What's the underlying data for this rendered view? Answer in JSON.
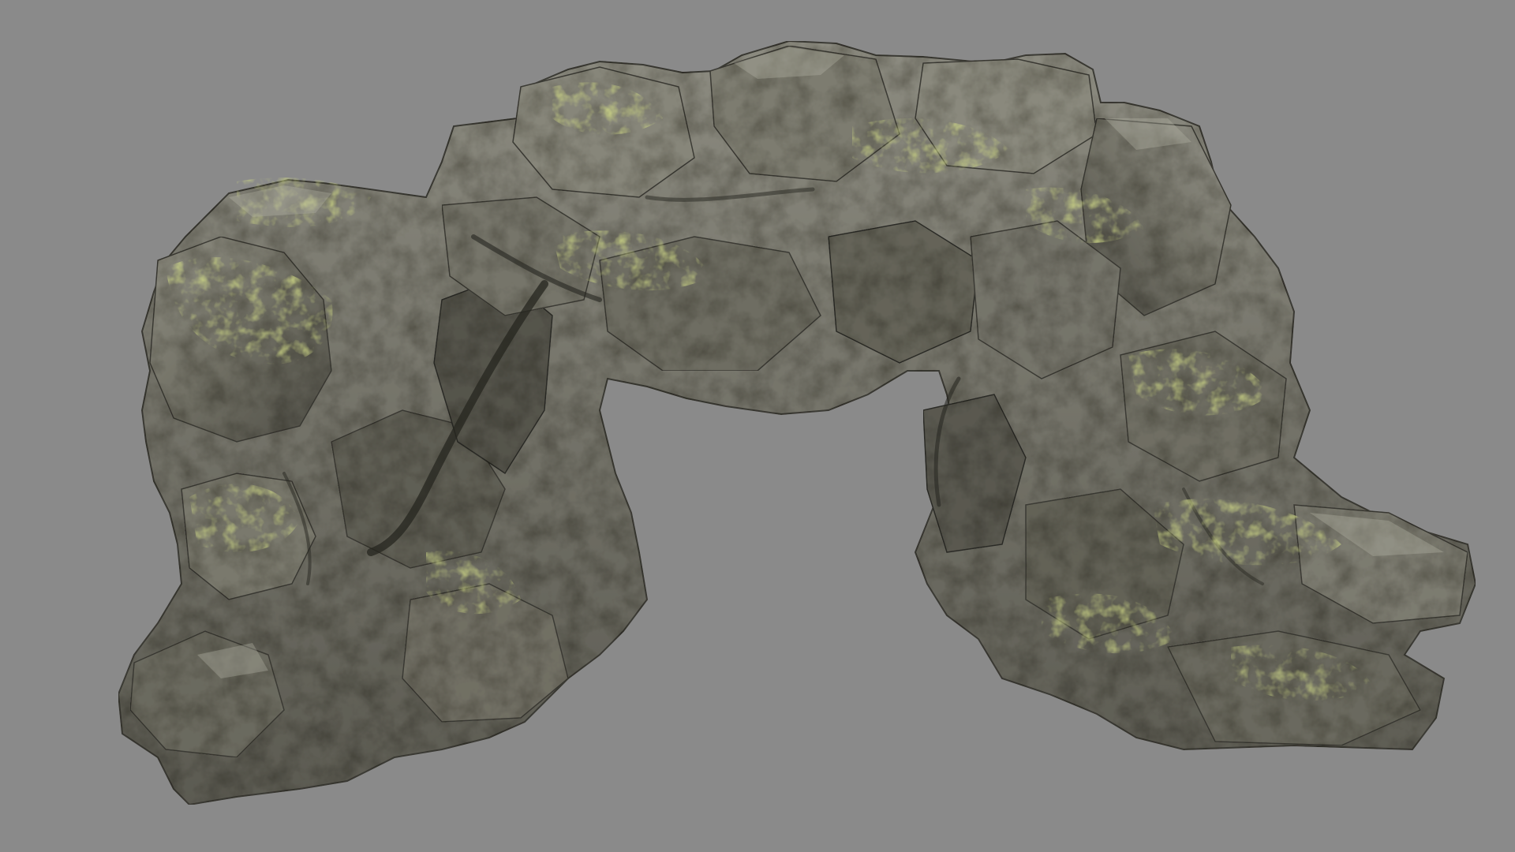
{
  "scene": {
    "subject": "rock-arch-model",
    "colors": {
      "background": "#8a8a8a",
      "rock_base": "#6b6a5f",
      "rock_dark": "#3a3a33",
      "rock_light": "#a8a79c",
      "moss": "#9aa83a",
      "moss_dark": "#6f7d2a"
    }
  }
}
